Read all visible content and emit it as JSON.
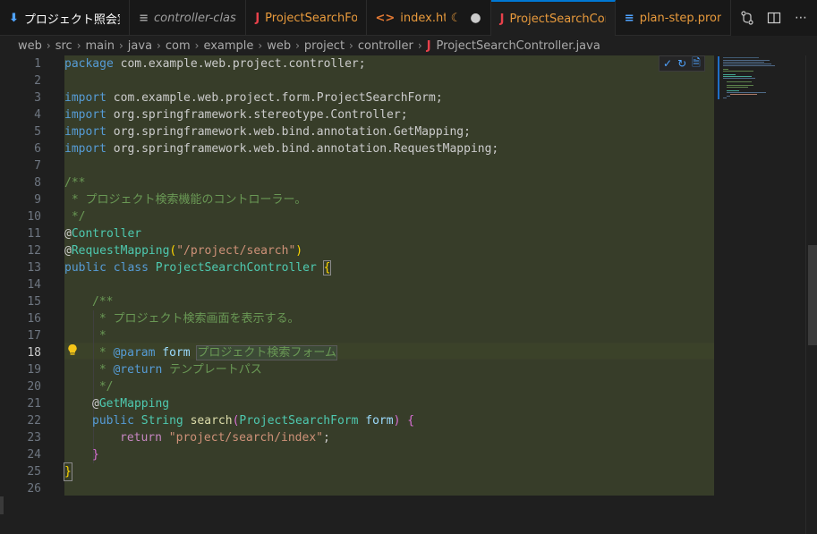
{
  "tabs": [
    {
      "icon": "⬇",
      "label": "プロジェクト照会実装",
      "italic": false
    },
    {
      "icon": "≡",
      "label": "controller-class.inst",
      "italic": true
    },
    {
      "icon": "J",
      "label": "ProjectSearchForm",
      "italic": false
    },
    {
      "icon": "<>",
      "label": "index.html",
      "italic": false,
      "status": "●"
    },
    {
      "icon": "J",
      "label": "ProjectSearchContr",
      "italic": false,
      "active": true
    },
    {
      "icon": "≡",
      "label": "plan-step.prompt.r",
      "italic": false
    }
  ],
  "breadcrumb": [
    "web",
    "src",
    "main",
    "java",
    "com",
    "example",
    "web",
    "project",
    "controller",
    "ProjectSearchController.java"
  ],
  "line_numbers": [
    "1",
    "2",
    "3",
    "4",
    "5",
    "6",
    "7",
    "8",
    "9",
    "10",
    "11",
    "12",
    "13",
    "14",
    "15",
    "16",
    "17",
    "18",
    "19",
    "20",
    "21",
    "22",
    "23",
    "24",
    "25",
    "26"
  ],
  "code": {
    "l1": "package com.example.web.project.controller;",
    "l3": "import com.example.web.project.form.ProjectSearchForm;",
    "l4": "import org.springframework.stereotype.Controller;",
    "l5": "import org.springframework.web.bind.annotation.GetMapping;",
    "l6": "import org.springframework.web.bind.annotation.RequestMapping;",
    "l8": "/**",
    "l9": " * プロジェクト検索機能のコントローラー。",
    "l10": " */",
    "l11_at": "@",
    "l11": "Controller",
    "l12_at": "@",
    "l12": "RequestMapping",
    "l12_str": "\"/project/search\"",
    "l13_kw1": "public",
    "l13_kw2": "class",
    "l13_name": "ProjectSearchController",
    "l15": "/**",
    "l16": " * プロジェクト検索画面を表示する。",
    "l17": " *",
    "l18_star": " * ",
    "l18_tag": "@param",
    "l18_param": "form",
    "l18_ghost": "プロジェクト検索フォーム",
    "l19_star": " * ",
    "l19_tag": "@return",
    "l19_ghost": "テンプレートパス",
    "l20": " */",
    "l21_at": "@",
    "l21": "GetMapping",
    "l22_kw": "public",
    "l22_type": "String",
    "l22_fn": "search",
    "l22_ptype": "ProjectSearchForm",
    "l22_pname": "form",
    "l23_kw": "return",
    "l23_str": "\"project/search/index\"",
    "l23_end": ";"
  },
  "inline_actions": [
    "✓",
    "↻",
    "🗎"
  ],
  "header_actions": [
    "compare-icon",
    "split-editor-icon",
    "more-icon"
  ]
}
